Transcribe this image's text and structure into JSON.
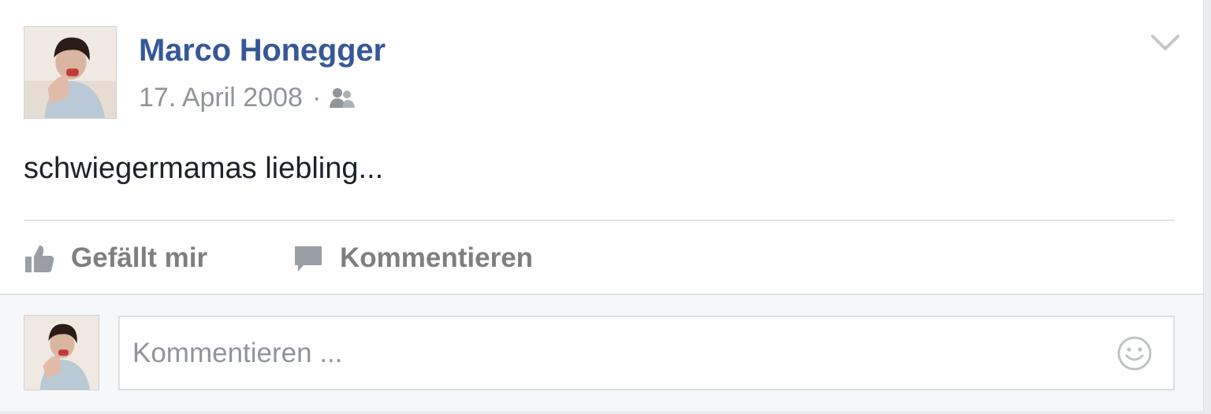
{
  "post": {
    "author_name": "Marco Honegger",
    "date": "17. April 2008",
    "separator": "·",
    "audience_icon": "friends-icon",
    "text": "schwiegermamas liebling..."
  },
  "actions": {
    "like_label": "Gefällt mir",
    "comment_label": "Kommentieren"
  },
  "comment_composer": {
    "placeholder": "Kommentieren ...",
    "emoji_icon": "smiley-icon"
  },
  "colors": {
    "author_link": "#365899",
    "meta_text": "#90949c",
    "action_text": "#7f7f7f",
    "comment_area_bg": "#f6f7f9"
  }
}
